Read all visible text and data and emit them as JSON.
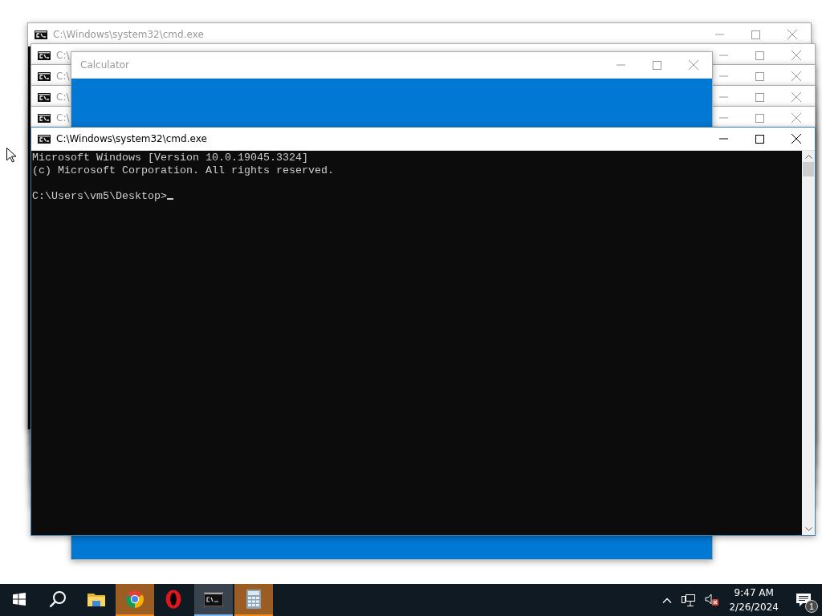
{
  "windows": [
    {
      "kind": "cmd",
      "title": "C:\\Windows\\system32\\cmd.exe",
      "active": false
    },
    {
      "kind": "cmd",
      "title": "C:\\",
      "active": false
    },
    {
      "kind": "cmd",
      "title": "C:\\",
      "active": false
    },
    {
      "kind": "cmd",
      "title": "C:\\",
      "active": false
    },
    {
      "kind": "cmd",
      "title": "C:\\",
      "active": false
    },
    {
      "kind": "calculator",
      "title": "Calculator",
      "active": false
    },
    {
      "kind": "cmd",
      "title": "C:\\Windows\\system32\\cmd.exe",
      "active": true,
      "console_lines": [
        "Microsoft Windows [Version 10.0.19045.3324]",
        "(c) Microsoft Corporation. All rights reserved."
      ],
      "prompt": "C:\\Users\\vm5\\Desktop>"
    }
  ],
  "taskbar": {
    "apps": [
      {
        "kind": "start",
        "flashing": false,
        "selected": false
      },
      {
        "kind": "search",
        "flashing": false,
        "selected": false
      },
      {
        "kind": "explorer",
        "flashing": false,
        "selected": false
      },
      {
        "kind": "chrome",
        "flashing": true,
        "selected": false
      },
      {
        "kind": "opera",
        "flashing": false,
        "selected": false
      },
      {
        "kind": "cmd",
        "flashing": false,
        "selected": true
      },
      {
        "kind": "calculator",
        "flashing": true,
        "selected": false
      }
    ],
    "clock": {
      "time": "9:47 AM",
      "date": "2/26/2024"
    },
    "notifications": {
      "count": "1"
    }
  }
}
